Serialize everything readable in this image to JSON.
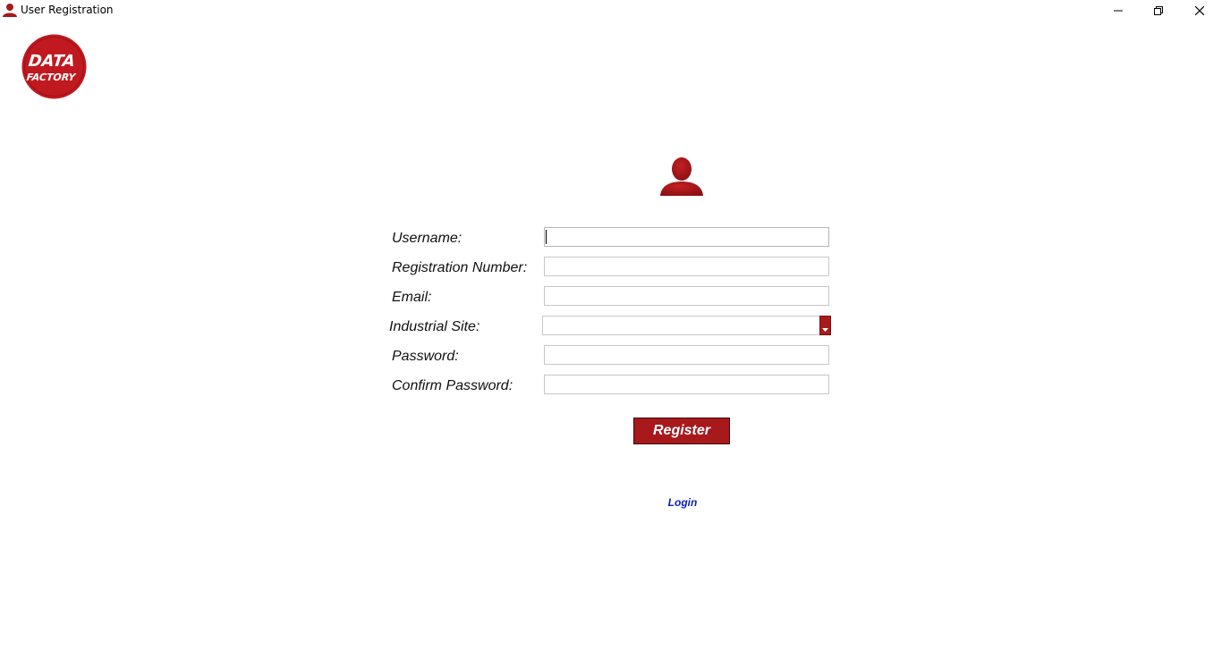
{
  "window": {
    "title": "User Registration",
    "app_icon": "user-icon",
    "controls": {
      "minimize": "minimize-icon",
      "restore": "restore-icon",
      "close": "close-icon"
    }
  },
  "logo": {
    "line1": "DATA",
    "line2": "FACTORY",
    "color": "#c0191f"
  },
  "form": {
    "icon": "user-icon",
    "accent_color": "#a8191c",
    "fields": {
      "username": {
        "label": "Username:",
        "value": ""
      },
      "registration_number": {
        "label": "Registration Number:",
        "value": ""
      },
      "email": {
        "label": "Email:",
        "value": ""
      },
      "industrial_site": {
        "label": "Industrial Site:",
        "selected": ""
      },
      "password": {
        "label": "Password:",
        "value": ""
      },
      "confirm_password": {
        "label": "Confirm Password:",
        "value": ""
      }
    },
    "register_label": "Register",
    "login_label": "Login"
  }
}
